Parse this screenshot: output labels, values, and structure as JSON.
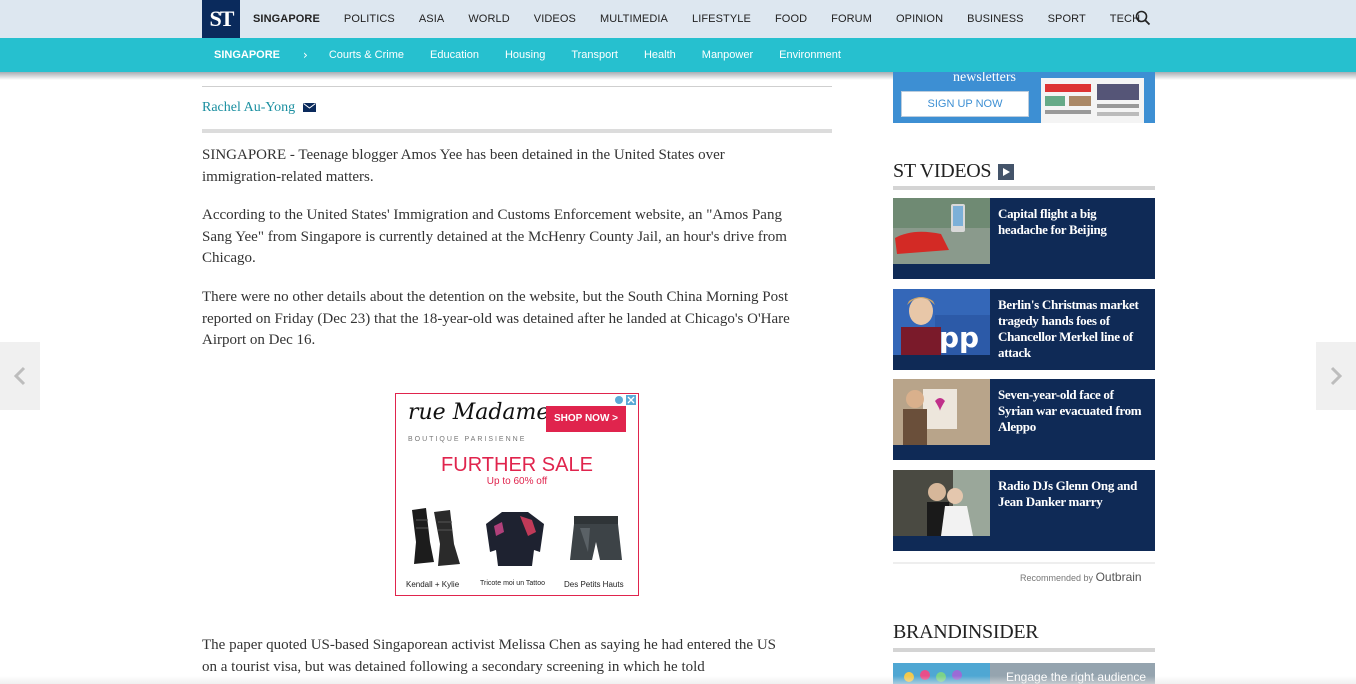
{
  "logo": {
    "text": "ST"
  },
  "topnav": {
    "items": [
      "SINGAPORE",
      "POLITICS",
      "ASIA",
      "WORLD",
      "VIDEOS",
      "MULTIMEDIA",
      "LIFESTYLE",
      "FOOD",
      "FORUM",
      "OPINION",
      "BUSINESS",
      "SPORT",
      "TECH"
    ],
    "active": "SINGAPORE",
    "search_icon": "search-icon"
  },
  "subnav": {
    "section": "SINGAPORE",
    "items": [
      "Courts & Crime",
      "Education",
      "Housing",
      "Transport",
      "Health",
      "Manpower",
      "Environment"
    ]
  },
  "article": {
    "author": "Rachel Au-Yong",
    "paragraphs": [
      "SINGAPORE - Teenage blogger Amos Yee has been detained in the United States over immigration-related matters.",
      "According to the United States' Immigration and Customs Enforcement website, an \"Amos Pang Sang Yee\" from Singapore is currently detained at the McHenry County Jail, an hour's drive from Chicago.",
      "There were no other details about the detention on the website, but the South China Morning Post reported on Friday (Dec 23) that the 18-year-old was detained after he landed at Chicago's O'Hare Airport on Dec 16.",
      "The paper quoted US-based Singaporean activist Melissa Chen as saying he had entered the US on a tourist visa, but was detained following a secondary screening in which he told"
    ]
  },
  "ad": {
    "brand": "rue Madame",
    "tagline": "BOUTIQUE PARISIENNE",
    "cta": "SHOP NOW >",
    "headline": "FURTHER SALE",
    "offer": "Up to 60% off",
    "products": [
      "Kendall + Kylie",
      "Tricote moi un Tattoo",
      "Des Petits Hauts"
    ],
    "brand_color": "#e0244d"
  },
  "sidebar": {
    "newsletter": {
      "word": "newsletters",
      "button": "SIGN UP NOW"
    },
    "videos_heading": "ST VIDEOS",
    "videos": [
      {
        "title": "Capital flight a big headache for Beijing"
      },
      {
        "title": "Berlin's Christmas market tragedy hands foes of Chancellor Merkel line of attack"
      },
      {
        "title": "Seven-year-old face of Syrian war evacuated from Aleppo"
      },
      {
        "title": "Radio DJs Glenn Ong and Jean Danker marry"
      }
    ],
    "recommended": {
      "label": "Recommended by",
      "brand": "Outbrain"
    },
    "brandinsider_heading": "BRANDINSIDER",
    "brandinsider_teaser": "Engage the right audience"
  },
  "colors": {
    "navy": "#0a2a5c",
    "teal": "#26c0cf",
    "link": "#1a8fa0",
    "video_bg": "#0f2a56"
  }
}
